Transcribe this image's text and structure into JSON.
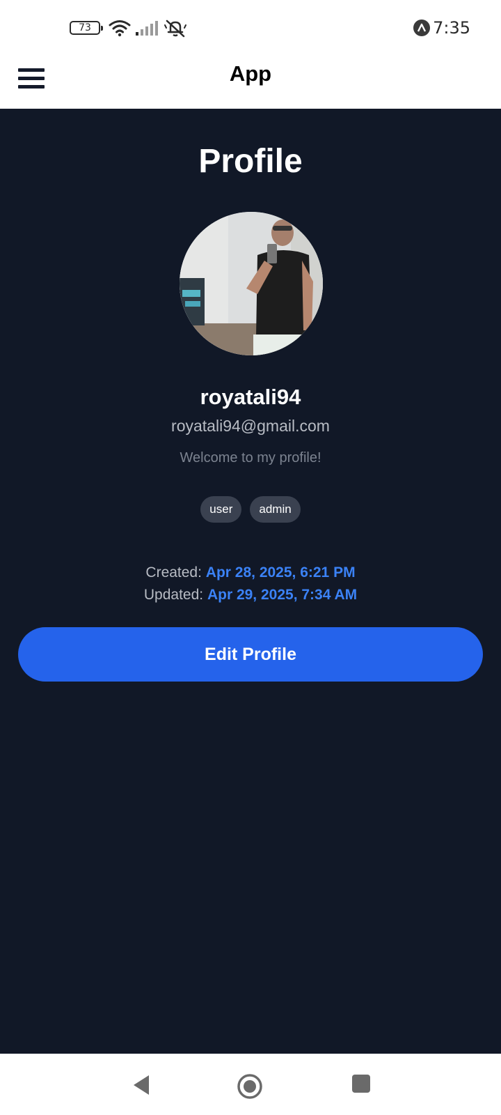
{
  "status_bar": {
    "battery_level": "73",
    "time": "7:35",
    "icons": [
      "battery-icon",
      "wifi-icon",
      "signal-icon",
      "bell-muted-icon",
      "app-notification-icon"
    ]
  },
  "app_bar": {
    "title": "App",
    "menu_icon": "hamburger-menu-icon"
  },
  "profile": {
    "page_title": "Profile",
    "username": "royatali94",
    "email": "royatali94@gmail.com",
    "bio": "Welcome to my profile!",
    "roles": [
      "user",
      "admin"
    ],
    "created_label": "Created:",
    "created_value": "Apr 28, 2025, 6:21 PM",
    "updated_label": "Updated:",
    "updated_value": "Apr 29, 2025, 7:34 AM",
    "edit_button_label": "Edit Profile"
  },
  "nav_bar": {
    "buttons": [
      "back-icon",
      "home-icon",
      "recents-icon"
    ]
  },
  "colors": {
    "background": "#111827",
    "accent": "#2563eb",
    "date_value": "#3b82f6",
    "chip": "#3a4150"
  }
}
